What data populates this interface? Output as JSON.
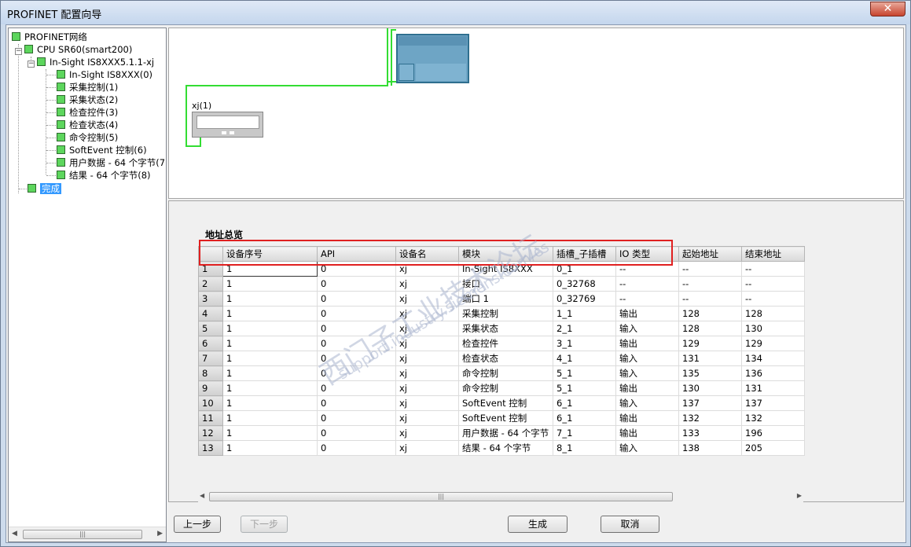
{
  "window": {
    "title": "PROFINET 配置向导",
    "close_glyph": "✕"
  },
  "tree": {
    "root": "PROFINET网络",
    "cpu": "CPU SR60(smart200)",
    "device": "In-Sight IS8XXX5.1.1-xj",
    "modules": [
      "In-Sight IS8XXX(0)",
      "采集控制(1)",
      "采集状态(2)",
      "检查控件(3)",
      "检查状态(4)",
      "命令控制(5)",
      "SoftEvent 控制(6)",
      "用户数据 - 64 个字节(7",
      "结果 - 64 个字节(8)"
    ],
    "done": "完成"
  },
  "topology": {
    "device_label": "xj(1)"
  },
  "address_overview": {
    "title": "地址总览",
    "columns": [
      "设备序号",
      "API",
      "设备名",
      "模块",
      "插槽_子插槽",
      "IO 类型",
      "起始地址",
      "结束地址"
    ],
    "rows": [
      [
        "1",
        "1",
        "0",
        "xj",
        "In-Sight IS8XXX",
        "0_1",
        "--",
        "--",
        "--"
      ],
      [
        "2",
        "1",
        "0",
        "xj",
        "接口",
        "0_32768",
        "--",
        "--",
        "--"
      ],
      [
        "3",
        "1",
        "0",
        "xj",
        "端口 1",
        "0_32769",
        "--",
        "--",
        "--"
      ],
      [
        "4",
        "1",
        "0",
        "xj",
        "采集控制",
        "1_1",
        "输出",
        "128",
        "128"
      ],
      [
        "5",
        "1",
        "0",
        "xj",
        "采集状态",
        "2_1",
        "输入",
        "128",
        "130"
      ],
      [
        "6",
        "1",
        "0",
        "xj",
        "检查控件",
        "3_1",
        "输出",
        "129",
        "129"
      ],
      [
        "7",
        "1",
        "0",
        "xj",
        "检查状态",
        "4_1",
        "输入",
        "131",
        "134"
      ],
      [
        "8",
        "1",
        "0",
        "xj",
        "命令控制",
        "5_1",
        "输入",
        "135",
        "136"
      ],
      [
        "9",
        "1",
        "0",
        "xj",
        "命令控制",
        "5_1",
        "输出",
        "130",
        "131"
      ],
      [
        "10",
        "1",
        "0",
        "xj",
        "SoftEvent 控制",
        "6_1",
        "输入",
        "137",
        "137"
      ],
      [
        "11",
        "1",
        "0",
        "xj",
        "SoftEvent 控制",
        "6_1",
        "输出",
        "132",
        "132"
      ],
      [
        "12",
        "1",
        "0",
        "xj",
        "用户数据 - 64 个字节",
        "7_1",
        "输出",
        "133",
        "196"
      ],
      [
        "13",
        "1",
        "0",
        "xj",
        "结果 - 64 个字节",
        "8_1",
        "输入",
        "138",
        "205"
      ]
    ]
  },
  "buttons": {
    "prev": "上一步",
    "next": "下一步",
    "generate": "生成",
    "cancel": "取消"
  },
  "watermark": {
    "line1": "西门子工业技术论坛",
    "line2": "support.industry.siemens.com/cs"
  },
  "colors": {
    "highlight": "#e02020",
    "link": "#00cc00",
    "node": "#5dd65d",
    "plc": "#6ea5c5"
  }
}
